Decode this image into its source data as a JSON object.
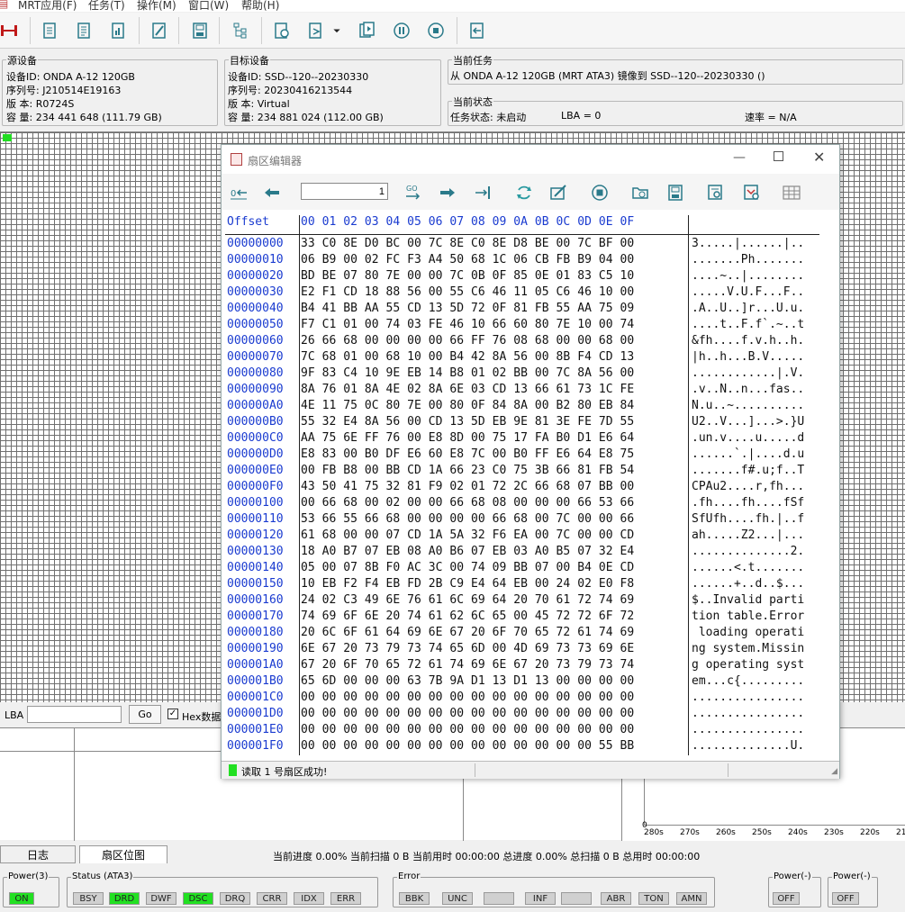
{
  "menu": [
    "MRT应用(F)",
    "任务(T)",
    "操作(M)",
    "窗口(W)",
    "帮助(H)"
  ],
  "source": {
    "title": "源设备",
    "lines": [
      "设备ID: ONDA A-12 120GB",
      "序列号: J210514E19163",
      "版  本: R0724S",
      "容  量: 234 441 648 (111.79 GB)"
    ]
  },
  "target": {
    "title": "目标设备",
    "lines": [
      "设备ID: SSD--120--20230330",
      "序列号: 20230416213544",
      "版  本: Virtual",
      "容  量: 234 881 024 (112.00 GB)"
    ]
  },
  "task": {
    "title": "当前任务",
    "line": "从 ONDA A-12 120GB (MRT ATA3) 镜像到 SSD--120--20230330 ()"
  },
  "state": {
    "title": "当前状态",
    "status": "任务状态: 未启动",
    "lba": "LBA = 0",
    "rate": "速率 = N/A"
  },
  "lba": {
    "label": "LBA",
    "go": "Go",
    "hex_label": "Hex数据"
  },
  "tabs": {
    "log": "日志",
    "map": "扇区位图"
  },
  "progress": "当前进度 0.00% 当前扫描 0 B 当前用时 00:00:00    总进度 0.00% 总扫描 0 B 总用时 00:00:00",
  "graph": {
    "y0": "0",
    "ticks": [
      "280s",
      "270s",
      "260s",
      "250s",
      "240s",
      "230s",
      "220s",
      "21"
    ]
  },
  "status_groups": {
    "power3": {
      "title": "Power(3)",
      "items": [
        "ON"
      ]
    },
    "status": {
      "title": "Status (ATA3)",
      "items": [
        "BSY",
        "DRD",
        "DWF",
        "DSC",
        "DRQ",
        "CRR",
        "IDX",
        "ERR"
      ],
      "active": [
        "DRD",
        "DSC"
      ]
    },
    "error": {
      "title": "Error",
      "items": [
        "BBK",
        "UNC",
        "",
        "INF",
        "",
        "ABR",
        "TON",
        "AMN"
      ]
    },
    "power_a": {
      "title": "Power(-)",
      "items": [
        "OFF"
      ]
    },
    "power_b": {
      "title": "Power(-)",
      "items": [
        "OFF"
      ]
    }
  },
  "dialog": {
    "title": "扇区编辑器",
    "sector_value": "1",
    "status": "读取 1 号扇区成功!",
    "header": {
      "offset": "Offset",
      "cols": "00 01 02 03 04 05 06 07 08 09 0A 0B 0C 0D 0E 0F"
    },
    "rows": [
      {
        "o": "00000000",
        "h": "33 C0 8E D0 BC 00 7C 8E C0 8E D8 BE 00 7C BF 00",
        "a": "3.....|......|.."
      },
      {
        "o": "00000010",
        "h": "06 B9 00 02 FC F3 A4 50 68 1C 06 CB FB B9 04 00",
        "a": ".......Ph......."
      },
      {
        "o": "00000020",
        "h": "BD BE 07 80 7E 00 00 7C 0B 0F 85 0E 01 83 C5 10",
        "a": "....~..|........"
      },
      {
        "o": "00000030",
        "h": "E2 F1 CD 18 88 56 00 55 C6 46 11 05 C6 46 10 00",
        "a": ".....V.U.F...F.."
      },
      {
        "o": "00000040",
        "h": "B4 41 BB AA 55 CD 13 5D 72 0F 81 FB 55 AA 75 09",
        "a": ".A..U..]r...U.u."
      },
      {
        "o": "00000050",
        "h": "F7 C1 01 00 74 03 FE 46 10 66 60 80 7E 10 00 74",
        "a": "....t..F.f`.~..t"
      },
      {
        "o": "00000060",
        "h": "26 66 68 00 00 00 00 66 FF 76 08 68 00 00 68 00",
        "a": "&fh....f.v.h..h."
      },
      {
        "o": "00000070",
        "h": "7C 68 01 00 68 10 00 B4 42 8A 56 00 8B F4 CD 13",
        "a": "|h..h...B.V....."
      },
      {
        "o": "00000080",
        "h": "9F 83 C4 10 9E EB 14 B8 01 02 BB 00 7C 8A 56 00",
        "a": "............|.V."
      },
      {
        "o": "00000090",
        "h": "8A 76 01 8A 4E 02 8A 6E 03 CD 13 66 61 73 1C FE",
        "a": ".v..N..n...fas.."
      },
      {
        "o": "000000A0",
        "h": "4E 11 75 0C 80 7E 00 80 0F 84 8A 00 B2 80 EB 84",
        "a": "N.u..~.........."
      },
      {
        "o": "000000B0",
        "h": "55 32 E4 8A 56 00 CD 13 5D EB 9E 81 3E FE 7D 55",
        "a": "U2..V...]...>.}U"
      },
      {
        "o": "000000C0",
        "h": "AA 75 6E FF 76 00 E8 8D 00 75 17 FA B0 D1 E6 64",
        "a": ".un.v....u.....d"
      },
      {
        "o": "000000D0",
        "h": "E8 83 00 B0 DF E6 60 E8 7C 00 B0 FF E6 64 E8 75",
        "a": "......`.|....d.u"
      },
      {
        "o": "000000E0",
        "h": "00 FB B8 00 BB CD 1A 66 23 C0 75 3B 66 81 FB 54",
        "a": ".......f#.u;f..T"
      },
      {
        "o": "000000F0",
        "h": "43 50 41 75 32 81 F9 02 01 72 2C 66 68 07 BB 00",
        "a": "CPAu2....r,fh..."
      },
      {
        "o": "00000100",
        "h": "00 66 68 00 02 00 00 66 68 08 00 00 00 66 53 66",
        "a": ".fh....fh....fSf"
      },
      {
        "o": "00000110",
        "h": "53 66 55 66 68 00 00 00 00 66 68 00 7C 00 00 66",
        "a": "SfUfh....fh.|..f"
      },
      {
        "o": "00000120",
        "h": "61 68 00 00 07 CD 1A 5A 32 F6 EA 00 7C 00 00 CD",
        "a": "ah.....Z2...|..."
      },
      {
        "o": "00000130",
        "h": "18 A0 B7 07 EB 08 A0 B6 07 EB 03 A0 B5 07 32 E4",
        "a": "..............2."
      },
      {
        "o": "00000140",
        "h": "05 00 07 8B F0 AC 3C 00 74 09 BB 07 00 B4 0E CD",
        "a": "......<.t......."
      },
      {
        "o": "00000150",
        "h": "10 EB F2 F4 EB FD 2B C9 E4 64 EB 00 24 02 E0 F8",
        "a": "......+..d..$..."
      },
      {
        "o": "00000160",
        "h": "24 02 C3 49 6E 76 61 6C 69 64 20 70 61 72 74 69",
        "a": "$..Invalid parti"
      },
      {
        "o": "00000170",
        "h": "74 69 6F 6E 20 74 61 62 6C 65 00 45 72 72 6F 72",
        "a": "tion table.Error"
      },
      {
        "o": "00000180",
        "h": "20 6C 6F 61 64 69 6E 67 20 6F 70 65 72 61 74 69",
        "a": " loading operati"
      },
      {
        "o": "00000190",
        "h": "6E 67 20 73 79 73 74 65 6D 00 4D 69 73 73 69 6E",
        "a": "ng system.Missin"
      },
      {
        "o": "000001A0",
        "h": "67 20 6F 70 65 72 61 74 69 6E 67 20 73 79 73 74",
        "a": "g operating syst"
      },
      {
        "o": "000001B0",
        "h": "65 6D 00 00 00 63 7B 9A D1 13 D1 13 00 00 00 00",
        "a": "em...c{........."
      },
      {
        "o": "000001C0",
        "h": "00 00 00 00 00 00 00 00 00 00 00 00 00 00 00 00",
        "a": "................"
      },
      {
        "o": "000001D0",
        "h": "00 00 00 00 00 00 00 00 00 00 00 00 00 00 00 00",
        "a": "................"
      },
      {
        "o": "000001E0",
        "h": "00 00 00 00 00 00 00 00 00 00 00 00 00 00 00 00",
        "a": "................"
      },
      {
        "o": "000001F0",
        "h": "00 00 00 00 00 00 00 00 00 00 00 00 00 00 55 BB",
        "a": "..............U."
      }
    ]
  },
  "colors": {
    "accent": "#1a3bd0",
    "on": "#22e022"
  }
}
